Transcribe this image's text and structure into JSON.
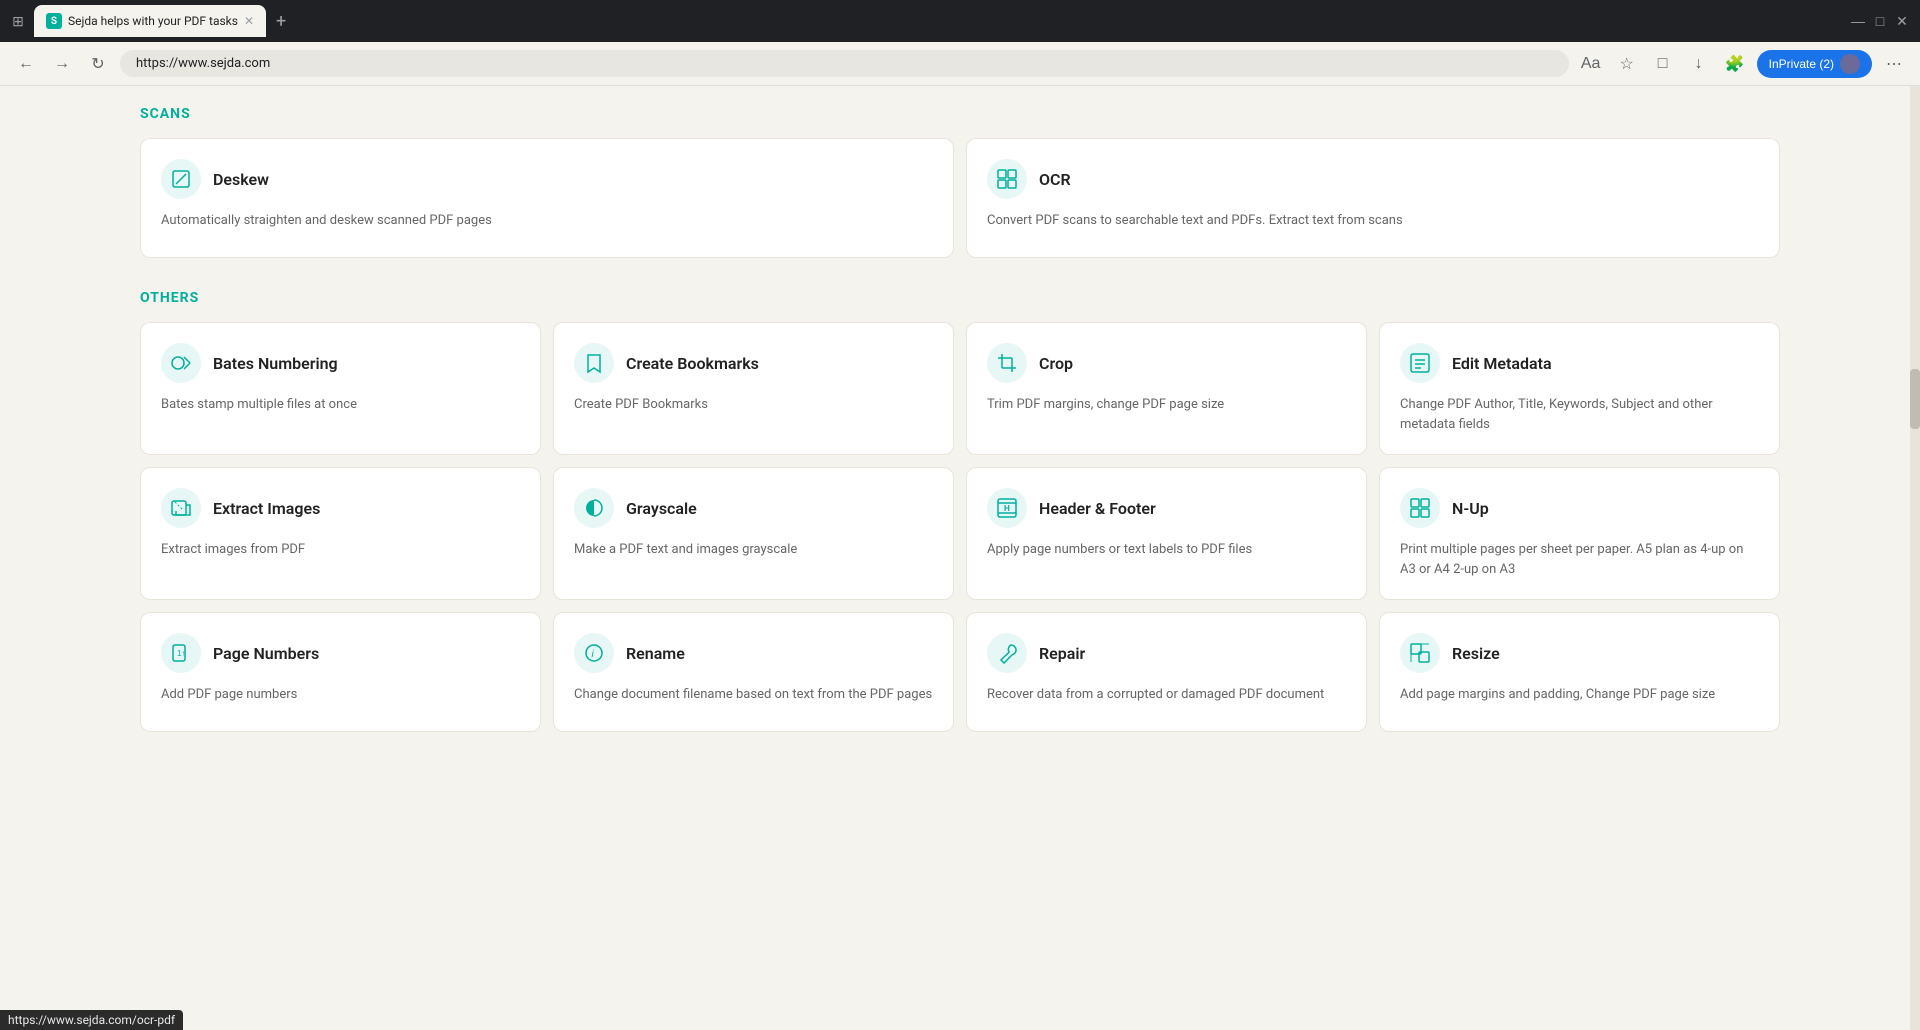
{
  "browser": {
    "tab_title": "Sejda helps with your PDF tasks",
    "tab_favicon": "S",
    "url": "https://www.sejda.com",
    "profile_label": "InPrivate (2)"
  },
  "sections": [
    {
      "id": "scans",
      "title": "SCANS",
      "cards": [
        {
          "id": "deskew",
          "title": "Deskew",
          "description": "Automatically straighten and deskew scanned PDF pages",
          "icon": "📄"
        },
        {
          "id": "ocr",
          "title": "OCR",
          "description": "Convert PDF scans to searchable text and PDFs. Extract text from scans",
          "icon": "⊞"
        }
      ]
    },
    {
      "id": "others",
      "title": "OTHERS",
      "cards": [
        {
          "id": "bates-numbering",
          "title": "Bates Numbering",
          "description": "Bates stamp multiple files at once",
          "icon": "🔎"
        },
        {
          "id": "create-bookmarks",
          "title": "Create Bookmarks",
          "description": "Create PDF Bookmarks",
          "icon": "🔖"
        },
        {
          "id": "crop",
          "title": "Crop",
          "description": "Trim PDF margins, change PDF page size",
          "icon": "✂"
        },
        {
          "id": "edit-metadata",
          "title": "Edit Metadata",
          "description": "Change PDF Author, Title, Keywords, Subject and other metadata fields",
          "icon": "⊟"
        },
        {
          "id": "extract-images",
          "title": "Extract Images",
          "description": "Extract images from PDF",
          "icon": "✏"
        },
        {
          "id": "grayscale",
          "title": "Grayscale",
          "description": "Make a PDF text and images grayscale",
          "icon": "✏"
        },
        {
          "id": "header-footer",
          "title": "Header & Footer",
          "description": "Apply page numbers or text labels to PDF files",
          "icon": "H"
        },
        {
          "id": "n-up",
          "title": "N-Up",
          "description": "Print multiple pages per sheet per paper. A5 plan as 4-up on A3 or A4 2-up on A3",
          "icon": "⊞"
        },
        {
          "id": "page-numbers",
          "title": "Page Numbers",
          "description": "Add PDF page numbers",
          "icon": "↑"
        },
        {
          "id": "rename",
          "title": "Rename",
          "description": "Change document filename based on text from the PDF pages",
          "icon": "ℹ"
        },
        {
          "id": "repair",
          "title": "Repair",
          "description": "Recover data from a corrupted or damaged PDF document",
          "icon": "🔧"
        },
        {
          "id": "resize",
          "title": "Resize",
          "description": "Add page margins and padding, Change PDF page size",
          "icon": "⊞"
        }
      ]
    }
  ],
  "status_bar": "https://www.sejda.com/ocr-pdf"
}
